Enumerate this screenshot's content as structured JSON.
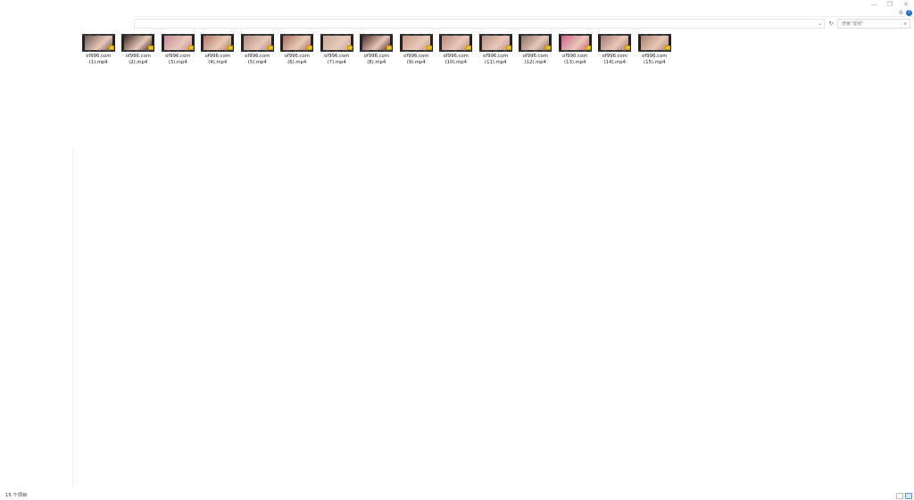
{
  "window": {
    "controls": {
      "minimize": "—",
      "maximize": "❐",
      "close": "✕"
    },
    "settings_glyph": "⚙",
    "help_glyph": "?"
  },
  "address": {
    "dropdown_glyph": "⌄",
    "refresh_glyph": "↻"
  },
  "search": {
    "placeholder": "搜索\"视频\"",
    "icon": "search-icon"
  },
  "files": [
    {
      "name": "of996.com\n(1).mp4",
      "thumb": "#6a5a55"
    },
    {
      "name": "of996.com\n(2).mp4",
      "thumb": "#3a2a28"
    },
    {
      "name": "of996.com\n(3).mp4",
      "thumb": "#c98a9a"
    },
    {
      "name": "of996.com\n(4).mp4",
      "thumb": "#b07868"
    },
    {
      "name": "of996.com\n(5).mp4",
      "thumb": "#b08a80"
    },
    {
      "name": "of996.com\n(6).mp4",
      "thumb": "#a87060"
    },
    {
      "name": "of996.com\n(7).mp4",
      "thumb": "#c8a898"
    },
    {
      "name": "of996.com\n(8).mp4",
      "thumb": "#4a2a2a"
    },
    {
      "name": "of996.com\n(9).mp4",
      "thumb": "#c89a88"
    },
    {
      "name": "of996.com\n(10).mp4",
      "thumb": "#b88a80"
    },
    {
      "name": "of996.com\n(11).mp4",
      "thumb": "#b89088"
    },
    {
      "name": "of996.com\n(12).mp4",
      "thumb": "#8a7068"
    },
    {
      "name": "of996.com\n(13).mp4",
      "thumb": "#d06090"
    },
    {
      "name": "of996.com\n(14).mp4",
      "thumb": "#a87878"
    },
    {
      "name": "of996.com\n(15).mp4",
      "thumb": "#a88070"
    }
  ],
  "status": {
    "item_count": "15 个项目"
  }
}
